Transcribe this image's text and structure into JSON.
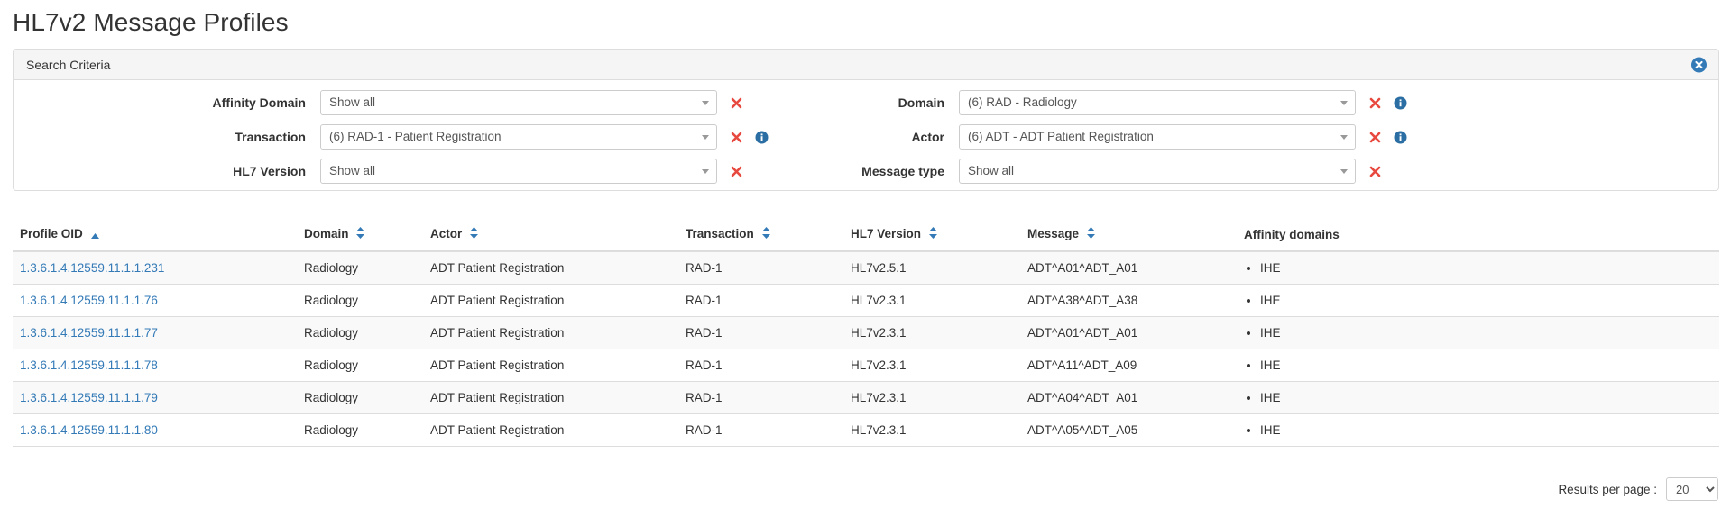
{
  "page": {
    "title": "HL7v2 Message Profiles"
  },
  "search_panel": {
    "title": "Search Criteria",
    "close_icon": "close-circle-icon",
    "left_fields": [
      {
        "label": "Affinity Domain",
        "value": "Show all",
        "clear_icon": "clear-x-icon",
        "has_info": false
      },
      {
        "label": "Transaction",
        "value": "(6) RAD-1 - Patient Registration",
        "clear_icon": "clear-x-icon",
        "has_info": true
      },
      {
        "label": "HL7 Version",
        "value": "Show all",
        "clear_icon": "clear-x-icon",
        "has_info": false
      }
    ],
    "right_fields": [
      {
        "label": "Domain",
        "value": "(6) RAD - Radiology",
        "clear_icon": "clear-x-icon",
        "has_info": true
      },
      {
        "label": "Actor",
        "value": "(6) ADT - ADT Patient Registration",
        "clear_icon": "clear-x-icon",
        "has_info": true
      },
      {
        "label": "Message type",
        "value": "Show all",
        "clear_icon": "clear-x-icon",
        "has_info": false
      }
    ]
  },
  "results_table": {
    "columns": [
      {
        "label": "Profile OID",
        "sort": "asc",
        "sort_icon": "sort-ascending-icon"
      },
      {
        "label": "Domain",
        "sort": "none",
        "sort_icon": "sort-both-icon"
      },
      {
        "label": "Actor",
        "sort": "none",
        "sort_icon": "sort-both-icon"
      },
      {
        "label": "Transaction",
        "sort": "none",
        "sort_icon": "sort-both-icon"
      },
      {
        "label": "HL7 Version",
        "sort": "none",
        "sort_icon": "sort-both-icon"
      },
      {
        "label": "Message",
        "sort": "none",
        "sort_icon": "sort-both-icon"
      },
      {
        "label": "Affinity domains",
        "sort": null,
        "sort_icon": null
      }
    ],
    "rows": [
      {
        "profile_oid": "1.3.6.1.4.12559.11.1.1.231",
        "domain": "Radiology",
        "actor": "ADT Patient Registration",
        "transaction": "RAD-1",
        "hl7_version": "HL7v2.5.1",
        "message": "ADT^A01^ADT_A01",
        "affinity_domains": [
          "IHE"
        ]
      },
      {
        "profile_oid": "1.3.6.1.4.12559.11.1.1.76",
        "domain": "Radiology",
        "actor": "ADT Patient Registration",
        "transaction": "RAD-1",
        "hl7_version": "HL7v2.3.1",
        "message": "ADT^A38^ADT_A38",
        "affinity_domains": [
          "IHE"
        ]
      },
      {
        "profile_oid": "1.3.6.1.4.12559.11.1.1.77",
        "domain": "Radiology",
        "actor": "ADT Patient Registration",
        "transaction": "RAD-1",
        "hl7_version": "HL7v2.3.1",
        "message": "ADT^A01^ADT_A01",
        "affinity_domains": [
          "IHE"
        ]
      },
      {
        "profile_oid": "1.3.6.1.4.12559.11.1.1.78",
        "domain": "Radiology",
        "actor": "ADT Patient Registration",
        "transaction": "RAD-1",
        "hl7_version": "HL7v2.3.1",
        "message": "ADT^A11^ADT_A09",
        "affinity_domains": [
          "IHE"
        ]
      },
      {
        "profile_oid": "1.3.6.1.4.12559.11.1.1.79",
        "domain": "Radiology",
        "actor": "ADT Patient Registration",
        "transaction": "RAD-1",
        "hl7_version": "HL7v2.3.1",
        "message": "ADT^A04^ADT_A01",
        "affinity_domains": [
          "IHE"
        ]
      },
      {
        "profile_oid": "1.3.6.1.4.12559.11.1.1.80",
        "domain": "Radiology",
        "actor": "ADT Patient Registration",
        "transaction": "RAD-1",
        "hl7_version": "HL7v2.3.1",
        "message": "ADT^A05^ADT_A05",
        "affinity_domains": [
          "IHE"
        ]
      }
    ]
  },
  "footer": {
    "results_per_page_label": "Results per page :",
    "results_per_page_value": "20",
    "results_per_page_options": [
      "20"
    ]
  },
  "colors": {
    "link": "#337ab7",
    "accent": "#337ab7",
    "clear_x": "#e8493f",
    "info": "#31708f",
    "panel_header_bg": "#f5f5f5",
    "border": "#dddddd",
    "row_alt_bg": "#f9f9f9",
    "text": "#333333"
  }
}
